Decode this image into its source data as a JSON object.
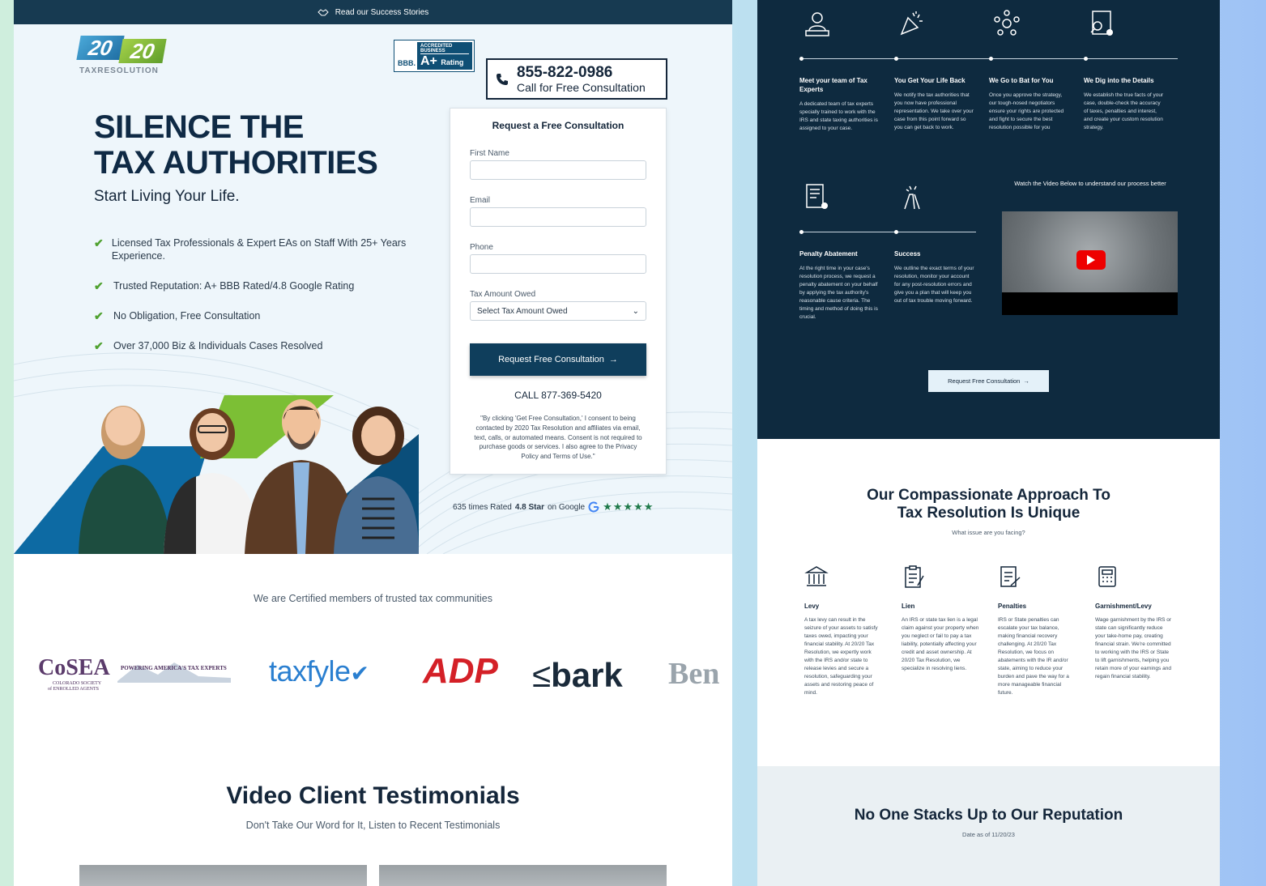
{
  "topbar": {
    "text": "Read our Success Stories"
  },
  "logo": {
    "part1": "20",
    "part2": "20",
    "tagline": "TAXRESOLUTION"
  },
  "bbb": {
    "accredited": "ACCREDITED BUSINESS",
    "seal": "BBB.",
    "rating": "A+",
    "rating_label": "Rating"
  },
  "phone": {
    "number": "855-822-0986",
    "cta": "Call for Free Consultation"
  },
  "hero": {
    "headline_line1": "SILENCE THE",
    "headline_line2": "TAX AUTHORITIES",
    "subhead": "Start Living Your Life.",
    "bullets": [
      "Licensed Tax Professionals & Expert EAs on Staff With 25+ Years Experience.",
      "Trusted Reputation: A+ BBB Rated/4.8 Google Rating",
      "No Obligation, Free Consultation",
      "Over 37,000 Biz & Individuals Cases Resolved"
    ]
  },
  "form": {
    "title": "Request a Free Consultation",
    "first_name_label": "First Name",
    "email_label": "Email",
    "phone_label": "Phone",
    "tax_label": "Tax Amount Owed",
    "tax_select": "Select Tax Amount Owed",
    "submit": "Request Free Consultation",
    "call": "CALL 877-369-5420",
    "legal": "\"By clicking 'Get Free Consultation,' I consent to being contacted by 2020 Tax Resolution and affiliates via email, text, calls, or automated means. Consent is not required to purchase goods or services. I also agree to the Privacy Policy and Terms of Use.\""
  },
  "google": {
    "prefix": "635 times Rated",
    "score": "4.8 Star",
    "suffix": "on Google",
    "stars": "★★★★★"
  },
  "certified": {
    "title": "We are Certified members of trusted tax communities",
    "cosea": "CoSEA",
    "cosea_tag": "POWERING AMERICA'S TAX EXPERTS",
    "cosea_sub1": "COLORADO SOCIETY",
    "cosea_sub2": "of ENROLLED AGENTS",
    "taxfyle": "taxfyle",
    "adp": "ADP",
    "bark": "bark",
    "ben": "Ben"
  },
  "testimonials": {
    "title": "Video Client Testimonials",
    "subtitle": "Don't Take Our Word for It, Listen to Recent Testimonials"
  },
  "process": {
    "steps": [
      {
        "title": "Meet your team of Tax Experts",
        "desc": "A dedicated team of tax experts specially trained to work with the IRS and state taxing authorities is assigned to your case.",
        "icon": "expert-team-icon"
      },
      {
        "title": "You Get Your Life Back",
        "desc": "We notify the tax authorities that you now have professional representation. We take over your case from this point forward so you can get back to work.",
        "icon": "celebrate-icon"
      },
      {
        "title": "We Go to Bat for You",
        "desc": "Once you approve the strategy, our tough-nosed negotiators ensure your rights are protected and fight to secure the best resolution possible for you",
        "icon": "network-icon"
      },
      {
        "title": "We Dig into the Details",
        "desc": "We establish the true facts of your case, double-check the accuracy of taxes, penalties and interest, and create your custom resolution strategy.",
        "icon": "document-search-icon"
      },
      {
        "title": "Penalty Abatement",
        "desc": "At the right time in your case's resolution process, we request a penalty abatement on your behalf by applying the tax authority's reasonable cause criteria. The timing and method of doing this is crucial.",
        "icon": "certificate-icon"
      },
      {
        "title": "Success",
        "desc": "We outline the exact terms of your resolution, monitor your account for any post-resolution errors and give you a plan that will keep you out of tax trouble moving forward.",
        "icon": "high-five-icon"
      }
    ],
    "watch": "Watch the Video Below to understand our process better",
    "button": "Request Free Consultation"
  },
  "approach": {
    "title_line1": "Our Compassionate Approach To",
    "title_line2": "Tax Resolution Is Unique",
    "subtitle": "What issue are you facing?",
    "issues": [
      {
        "title": "Levy",
        "desc": "A tax levy can result in the seizure of your assets to satisfy taxes owed, impacting your financial stability. At 20/20 Tax Resolution, we expertly work with the IRS and/or state to release levies and secure a resolution, safeguarding your assets and restoring peace of mind.",
        "icon": "bank-icon"
      },
      {
        "title": "Lien",
        "desc": "An IRS or state tax lien is a legal claim against your property when you neglect or fail to pay a tax liability, potentially affecting your credit and asset ownership. At 20/20 Tax Resolution, we specialize in resolving liens.",
        "icon": "clipboard-icon"
      },
      {
        "title": "Penalties",
        "desc": "IRS or State penalties can escalate your tax balance, making financial recovery challenging. At 20/20 Tax Resolution, we focus on abatements with the IR and/or state, aiming to reduce your burden and pave the way for a more manageable financial future.",
        "icon": "document-pen-icon"
      },
      {
        "title": "Garnishment/Levy",
        "desc": "Wage garnishment by the IRS or state can significantly reduce your take-home pay, creating financial strain. We're committed to working with the IRS or State to lift garnishments, helping you retain more of your earnings and regain financial stability.",
        "icon": "calculator-icon"
      }
    ]
  },
  "reputation": {
    "title": "No One Stacks Up to Our Reputation",
    "subtitle": "Date as of 11/20/23"
  }
}
